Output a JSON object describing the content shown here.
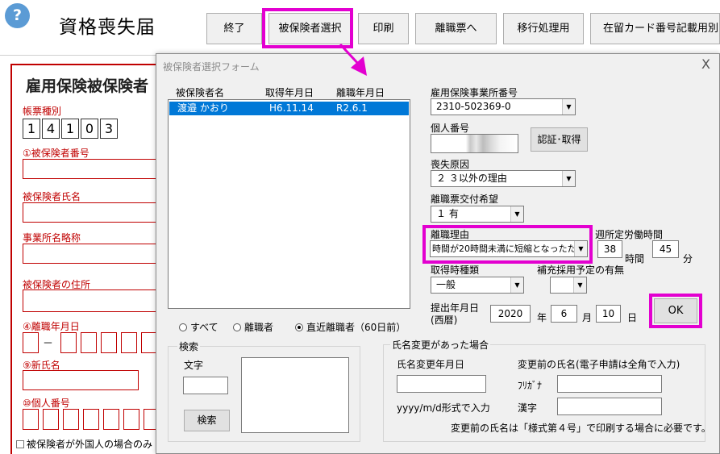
{
  "app": {
    "title": "資格喪失届",
    "help_icon": "?",
    "toolbar": [
      "終了",
      "被保険者選択",
      "印刷",
      "離職票へ",
      "移行処理用",
      "在留カード番号記載用別"
    ]
  },
  "form": {
    "heading": "雇用保険被保険者",
    "labels": {
      "ledger_type": "帳票種別",
      "insured_no": "①被保険者番号",
      "insured_name": "被保険者氏名",
      "office_abbr": "事業所名略称",
      "address": "被保険者の住所",
      "retire_date": "④離職年月日",
      "new_name": "⑨新氏名",
      "personal_no": "⑩個人番号"
    },
    "ledger_digits": [
      "1",
      "4",
      "1",
      "0",
      "3"
    ],
    "date_dash": "－",
    "foreign_checkbox": "被保険者が外国人の場合のみ"
  },
  "dialog": {
    "title": "被保険者選択フォーム",
    "close": "X",
    "list": {
      "headers": [
        "被保険者名",
        "取得年月日",
        "離職年月日"
      ],
      "rows": [
        {
          "name": "渡邉 かおり",
          "acquired": "H6.11.14",
          "left": "R2.6.1"
        }
      ]
    },
    "filters": [
      {
        "label": "すべて",
        "selected": false
      },
      {
        "label": "離職者",
        "selected": false
      },
      {
        "label": "直近離職者（60日前）",
        "selected": true
      }
    ],
    "search": {
      "group_title": "検索",
      "text_label": "文字",
      "button": "検索"
    },
    "office_no": {
      "label": "雇用保険事業所番号",
      "value": "2310-502369-0"
    },
    "personal_no": {
      "label": "個人番号",
      "auth_button": "認証･取得"
    },
    "loss_reason": {
      "label": "喪失原因",
      "value": "２ ３以外の理由"
    },
    "separation_slip": {
      "label": "離職票交付希望",
      "value": "１ 有"
    },
    "separation_reason": {
      "label": "離職理由",
      "value": "時間が20時間未満に短縮となったため"
    },
    "weekly_hours": {
      "label": "週所定労働時間",
      "hours": "38",
      "hours_unit": "時間",
      "minutes": "45",
      "minutes_unit": "分"
    },
    "acq_type": {
      "label": "取得時種類",
      "value": "一般"
    },
    "replacement": {
      "label": "補充採用予定の有無",
      "value": ""
    },
    "submit_date": {
      "label1": "提出年月日",
      "label2": "(西暦)",
      "year": "2020",
      "year_unit": "年",
      "month": "6",
      "month_unit": "月",
      "day": "10",
      "day_unit": "日"
    },
    "ok_button": "OK",
    "name_change": {
      "group_title": "氏名変更があった場合",
      "date_label": "氏名変更年月日",
      "format_hint": "yyyy/m/d形式で入力",
      "prev_name_label": "変更前の氏名(電子申請は全角で入力)",
      "kana_label": "ﾌﾘｶﾞﾅ",
      "kanji_label": "漢字",
      "note": "変更前の氏名は「様式第４号」で印刷する場合に必要です。"
    }
  },
  "colors": {
    "highlight": "#e300d0",
    "selection": "#0078d7",
    "form_red": "#c00000"
  }
}
